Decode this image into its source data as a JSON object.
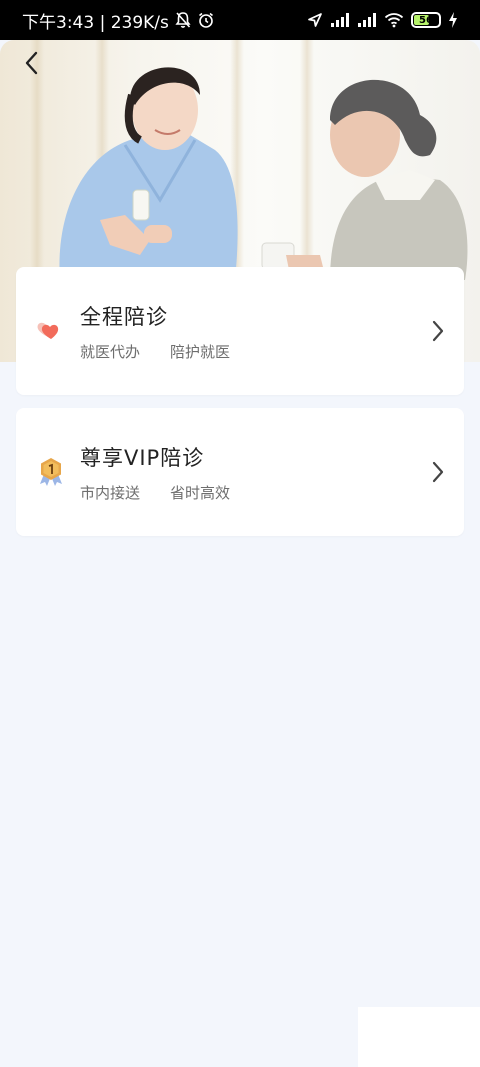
{
  "status_bar": {
    "time_speed": "下午3:43 | 239K/s",
    "battery": "56"
  },
  "services": [
    {
      "title": "全程陪诊",
      "tags": [
        "就医代办",
        "陪护就医"
      ],
      "icon": "heart-icon"
    },
    {
      "title": "尊享VIP陪诊",
      "tags": [
        "市内接送",
        "省时高效"
      ],
      "icon": "medal-icon"
    }
  ],
  "colors": {
    "background": "#f3f6fc",
    "card": "#ffffff",
    "heart": "#f26b5b",
    "medal": "#e7a64a"
  }
}
